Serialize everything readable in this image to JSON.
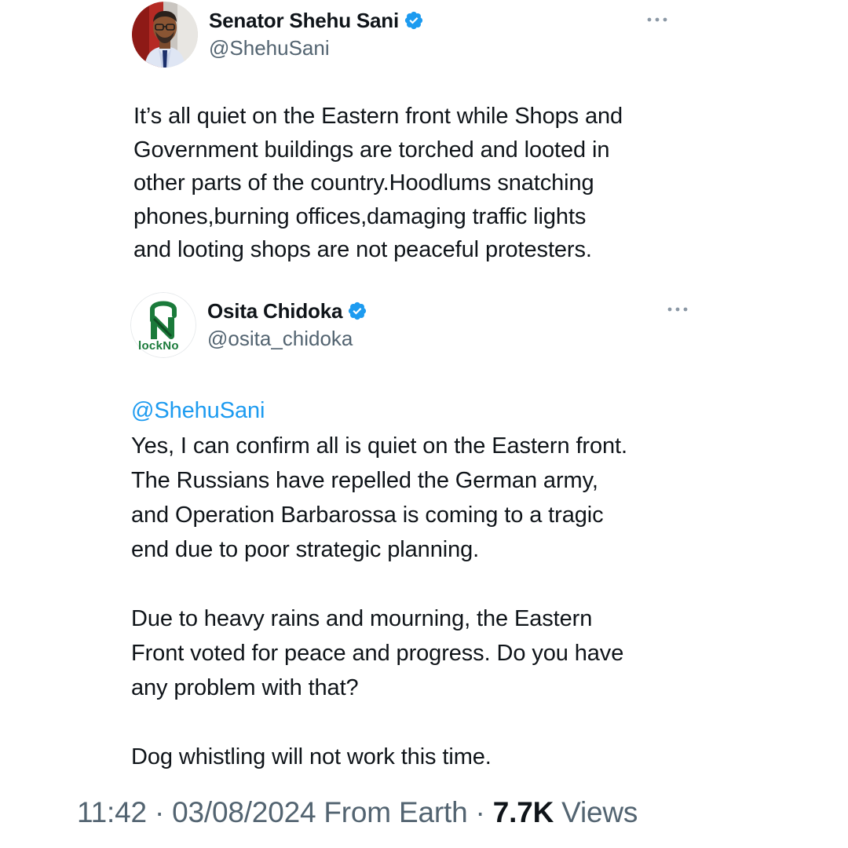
{
  "quoted_tweet": {
    "display_name": "Senator Shehu Sani",
    "handle": "@ShehuSani",
    "verified": true,
    "avatar_icon": "portrait-avatar",
    "more_icon": "more-horizontal-icon",
    "text": "It’s all quiet on the Eastern front while Shops and\nGovernment buildings are torched and looted in\nother parts of the country.Hoodlums snatching\nphones,burning offices,damaging traffic lights\nand looting shops are not peaceful protesters."
  },
  "reply_tweet": {
    "display_name": "Osita Chidoka",
    "handle": "@osita_chidoka",
    "verified": true,
    "avatar_icon": "locknow-logo-avatar",
    "avatar_logo_text": "lockNo",
    "more_icon": "more-horizontal-icon",
    "mention": "@ShehuSani",
    "text": "Yes, I can confirm all is quiet on the Eastern front.\nThe Russians have repelled the German army,\nand Operation Barbarossa is coming to a tragic\nend due to poor strategic planning.\n\nDue to heavy rains and mourning, the Eastern\nFront voted for peace and progress. Do you have\nany problem with that?\n\nDog whistling will not work this time."
  },
  "meta": {
    "time": "11:42",
    "separator": " · ",
    "date": "03/08/2024",
    "source": " From Earth",
    "separator2": " · ",
    "views_count": "7.7K",
    "views_label": " Views"
  },
  "colors": {
    "verified": "#1d9bf0",
    "mention": "#1d9bf0",
    "secondary_text": "#536471",
    "primary_text": "#0f1419",
    "logo_green": "#1a7a3a"
  }
}
